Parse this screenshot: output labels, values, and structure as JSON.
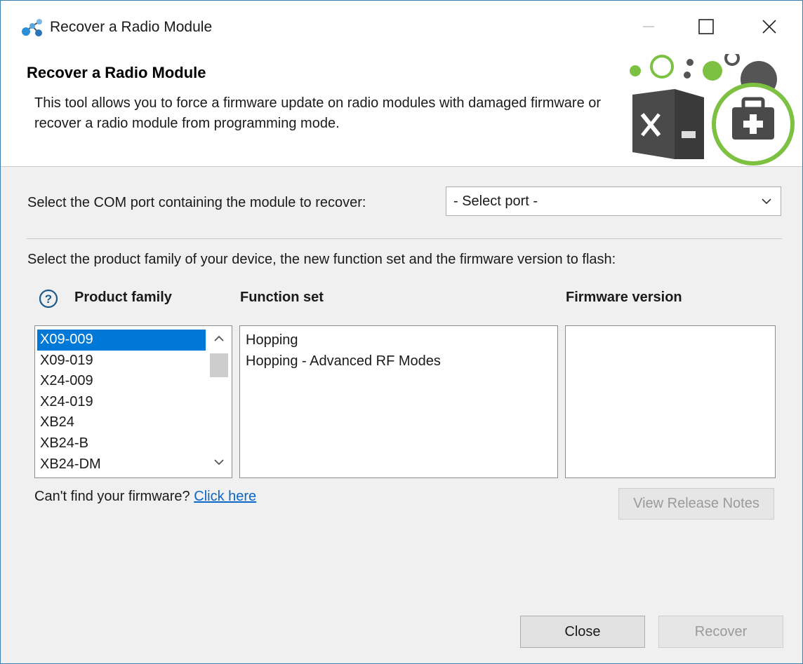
{
  "window": {
    "title": "Recover a Radio Module",
    "app_icon": "network-nodes-icon",
    "controls": [
      "minimize-icon",
      "maximize-icon",
      "close-icon"
    ]
  },
  "banner": {
    "title": "Recover a Radio Module",
    "description": "This tool allows you to force a firmware update on radio modules with damaged firmware or recover a radio module from programming mode.",
    "art_icon": "toolbox-first-aid-icon",
    "accent_color": "#7dc142"
  },
  "com_port": {
    "label": "Select the COM port containing the module to recover:",
    "selected": "- Select port -"
  },
  "selection": {
    "description": "Select the product family of your device, the new function set and the firmware version to flash:",
    "help_icon": "question-circle-icon",
    "headers": {
      "product_family": "Product family",
      "function_set": "Function set",
      "firmware_version": "Firmware version"
    },
    "product_families": [
      "X09-009",
      "X09-019",
      "X24-009",
      "X24-019",
      "XB24",
      "XB24-B",
      "XB24-DM"
    ],
    "selected_product_family": "X09-009",
    "function_sets": [
      "Hopping",
      "Hopping - Advanced RF Modes"
    ],
    "firmware_versions": []
  },
  "footer_link": {
    "prefix": "Can't find your firmware?",
    "link_text": "Click here"
  },
  "buttons": {
    "view_release_notes": "View Release Notes",
    "close": "Close",
    "recover": "Recover"
  },
  "colors": {
    "selection": "#0078d7",
    "link": "#0b66c5",
    "window_border": "#3c7fb1"
  }
}
